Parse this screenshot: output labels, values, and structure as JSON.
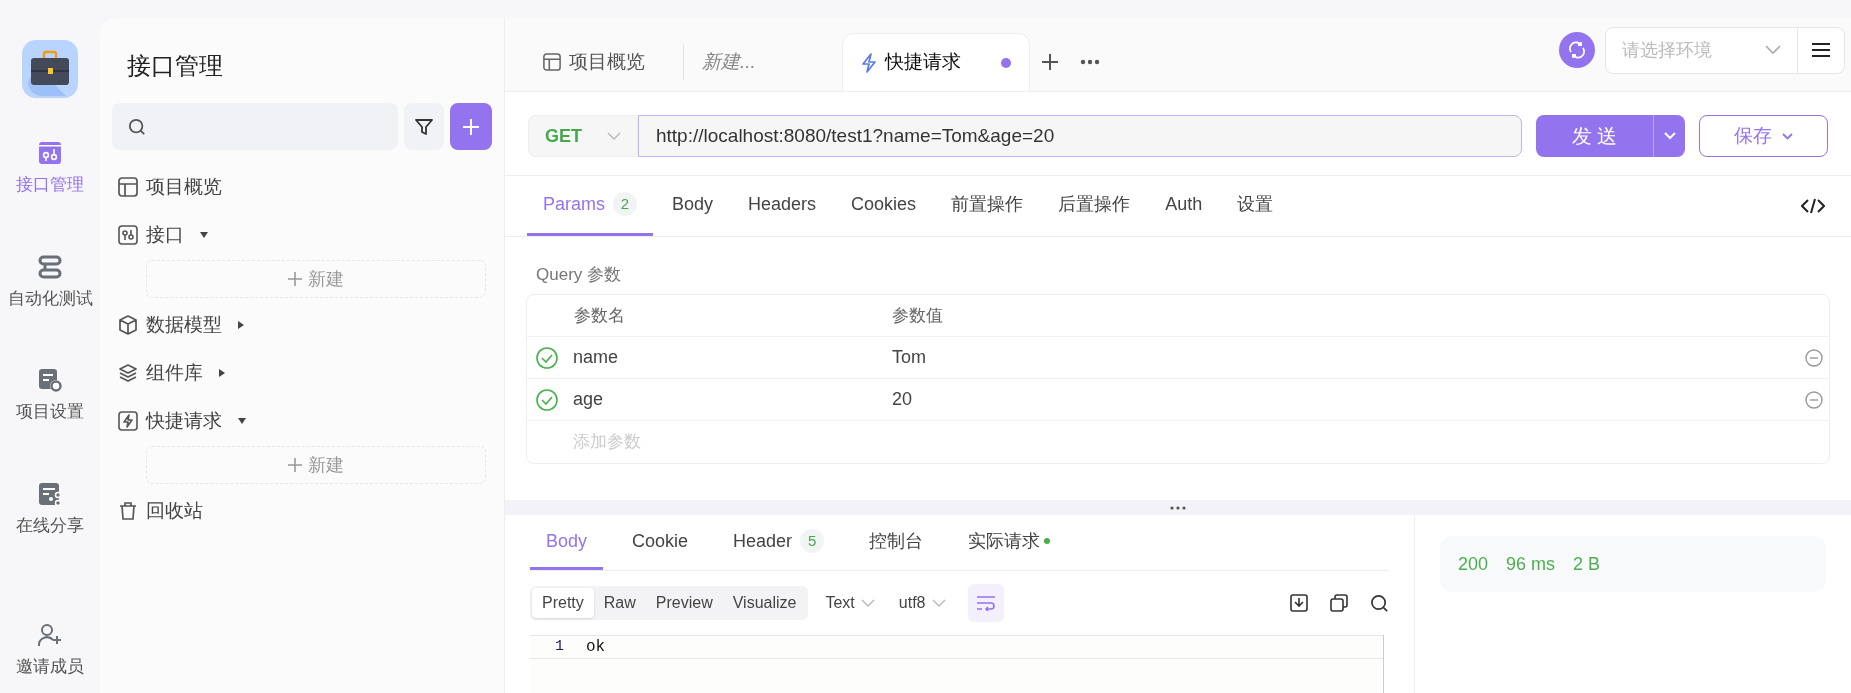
{
  "rail": {
    "items": [
      {
        "label": "接口管理",
        "selected": true
      },
      {
        "label": "自动化测试",
        "selected": false
      },
      {
        "label": "项目设置",
        "selected": false
      },
      {
        "label": "在线分享",
        "selected": false
      },
      {
        "label": "邀请成员",
        "selected": false
      }
    ]
  },
  "sidebar": {
    "title": "接口管理",
    "items": [
      {
        "label": "项目概览",
        "kind": "page"
      },
      {
        "label": "接口",
        "kind": "folder",
        "expanded": true,
        "new_button": "新建"
      },
      {
        "label": "数据模型",
        "kind": "folder",
        "expanded": false
      },
      {
        "label": "组件库",
        "kind": "folder",
        "expanded": false
      },
      {
        "label": "快捷请求",
        "kind": "folder",
        "expanded": true,
        "new_button": "新建"
      },
      {
        "label": "回收站",
        "kind": "page"
      }
    ]
  },
  "tabs": [
    {
      "label": "项目概览",
      "kind": "overview",
      "selected": false
    },
    {
      "label": "新建...",
      "kind": "draft",
      "selected": false
    },
    {
      "label": "快捷请求",
      "kind": "quick",
      "selected": true,
      "unsaved": true
    }
  ],
  "environment": {
    "placeholder": "请选择环境"
  },
  "request": {
    "method": "GET",
    "url": "http://localhost:8080/test1?name=Tom&age=20",
    "send": "发 送",
    "save": "保存"
  },
  "request_tabs": [
    {
      "label": "Params",
      "count": "2",
      "selected": true
    },
    {
      "label": "Body",
      "selected": false
    },
    {
      "label": "Headers",
      "selected": false
    },
    {
      "label": "Cookies",
      "selected": false
    },
    {
      "label": "前置操作",
      "selected": false
    },
    {
      "label": "后置操作",
      "selected": false
    },
    {
      "label": "Auth",
      "selected": false
    },
    {
      "label": "设置",
      "selected": false
    }
  ],
  "params": {
    "section_title": "Query 参数",
    "columns": [
      "参数名",
      "参数值"
    ],
    "rows": [
      {
        "name": "name",
        "value": "Tom",
        "enabled": true
      },
      {
        "name": "age",
        "value": "20",
        "enabled": true
      }
    ],
    "add_placeholder": "添加参数"
  },
  "response_tabs": [
    {
      "label": "Body",
      "selected": true
    },
    {
      "label": "Cookie",
      "selected": false
    },
    {
      "label": "Header",
      "count": "5",
      "selected": false
    },
    {
      "label": "控制台",
      "selected": false
    },
    {
      "label": "实际请求",
      "selected": false,
      "indicator": true
    }
  ],
  "view_modes": [
    {
      "label": "Pretty",
      "selected": true
    },
    {
      "label": "Raw",
      "selected": false
    },
    {
      "label": "Preview",
      "selected": false
    },
    {
      "label": "Visualize",
      "selected": false
    }
  ],
  "format": "Text",
  "encoding": "utf8",
  "wrap_enabled": true,
  "editor": {
    "lines": [
      {
        "number": "1",
        "text": "ok"
      }
    ]
  },
  "status": {
    "code": "200",
    "time": "96 ms",
    "size": "2 B"
  }
}
